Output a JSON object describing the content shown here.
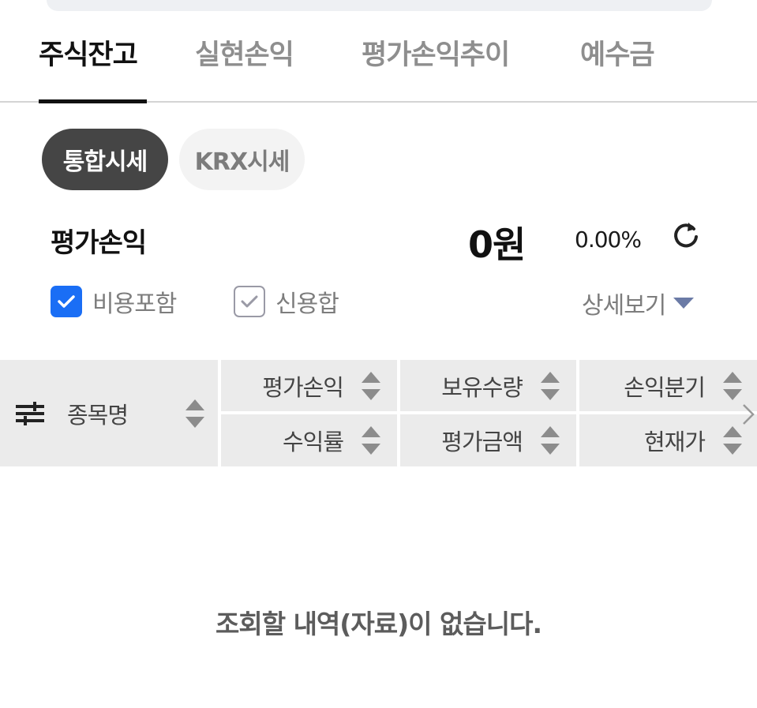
{
  "tabs": [
    {
      "label": "주식잔고",
      "active": true
    },
    {
      "label": "실현손익",
      "active": false
    },
    {
      "label": "평가손익추이",
      "active": false
    },
    {
      "label": "예수금",
      "active": false
    }
  ],
  "price_mode": {
    "options": [
      {
        "label": "통합시세",
        "active": true
      },
      {
        "label": "KRX시세",
        "active": false
      }
    ]
  },
  "summary": {
    "label": "평가손익",
    "amount": "0원",
    "rate": "0.00%"
  },
  "options": {
    "include_cost": {
      "label": "비용포함",
      "checked": true
    },
    "credit_sum": {
      "label": "신용합",
      "checked": false
    },
    "detail_label": "상세보기"
  },
  "table": {
    "name_header": "종목명",
    "headers_top": [
      "평가손익",
      "보유수량",
      "손익분기"
    ],
    "headers_bottom": [
      "수익률",
      "평가금액",
      "현재가"
    ]
  },
  "empty_message": "조회할 내역(자료)이 없습니다.",
  "colors": {
    "accent_blue": "#1a6ef5",
    "pill_active_bg": "#454545",
    "header_bg": "#ebebeb"
  },
  "icons": [
    "filter-icon",
    "refresh-icon",
    "check-icon",
    "sort-icon",
    "chevron-right-icon",
    "caret-down-icon"
  ]
}
